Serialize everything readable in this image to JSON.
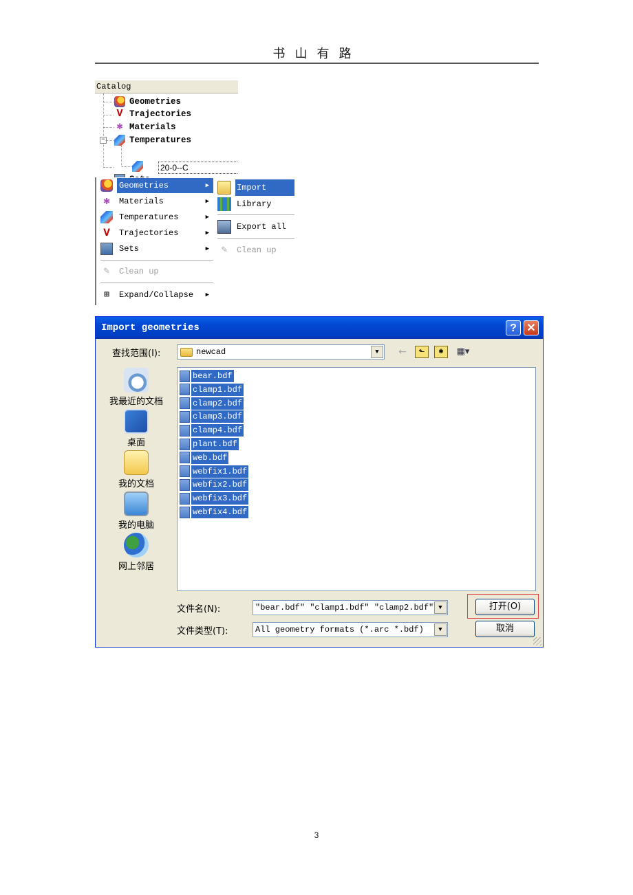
{
  "page": {
    "header": "书山有路",
    "page_number": "3"
  },
  "catalog": {
    "title": "Catalog",
    "items": [
      {
        "label": "Geometries",
        "icon": "geometries-icon"
      },
      {
        "label": "Trajectories",
        "icon": "trajectories-icon"
      },
      {
        "label": "Materials",
        "icon": "materials-icon"
      },
      {
        "label": "Temperatures",
        "icon": "temperatures-icon",
        "expanded": true,
        "children": [
          {
            "label": "20-0--C"
          }
        ]
      },
      {
        "label": "Sets",
        "icon": "sets-icon"
      }
    ]
  },
  "context_menu": {
    "items": [
      {
        "label": "Geometries",
        "has_submenu": true,
        "active": true
      },
      {
        "label": "Materials",
        "has_submenu": true
      },
      {
        "label": "Temperatures",
        "has_submenu": true
      },
      {
        "label": "Trajectories",
        "has_submenu": true
      },
      {
        "label": "Sets",
        "has_submenu": true
      },
      {
        "label": "Clean up",
        "disabled": true
      },
      {
        "label": "Expand/Collapse",
        "has_submenu": true
      }
    ],
    "submenu": [
      {
        "label": "Import",
        "active": true
      },
      {
        "label": "Library"
      },
      {
        "label": "Export all"
      },
      {
        "label": "Clean up",
        "disabled": true
      }
    ]
  },
  "dialog": {
    "title": "Import geometries",
    "help_label": "?",
    "close_label": "✕",
    "look_in_label": "查找范围(I):",
    "look_in_value": "newcad",
    "toolbar": {
      "back": "←",
      "up": "⬑",
      "new_folder": "✱",
      "view": "▦▾"
    },
    "places": [
      {
        "label": "我最近的文档",
        "icon": "recent-documents-icon"
      },
      {
        "label": "桌面",
        "icon": "desktop-icon"
      },
      {
        "label": "我的文档",
        "icon": "my-documents-icon"
      },
      {
        "label": "我的电脑",
        "icon": "my-computer-icon"
      },
      {
        "label": "网上邻居",
        "icon": "network-places-icon"
      }
    ],
    "files": [
      "bear.bdf",
      "clamp1.bdf",
      "clamp2.bdf",
      "clamp3.bdf",
      "clamp4.bdf",
      "plant.bdf",
      "web.bdf",
      "webfix1.bdf",
      "webfix2.bdf",
      "webfix3.bdf",
      "webfix4.bdf"
    ],
    "filename_label": "文件名(N):",
    "filename_value": "\"bear.bdf\" \"clamp1.bdf\" \"clamp2.bdf\" \"",
    "filetype_label": "文件类型(T):",
    "filetype_value": "All geometry formats (*.arc *.bdf)",
    "open_label": "打开(O)",
    "cancel_label": "取消",
    "accent": "#316AC5",
    "highlight_border": "#E04040"
  }
}
